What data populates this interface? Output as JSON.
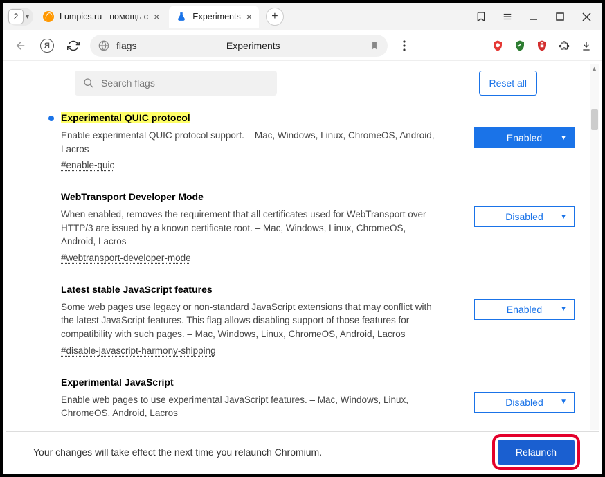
{
  "titlebar": {
    "tab_count": "2",
    "tabs": [
      {
        "label": "Lumpics.ru - помощь с"
      },
      {
        "label": "Experiments"
      }
    ]
  },
  "addrbar": {
    "flags_text": "flags",
    "page_title": "Experiments",
    "ya_letter": "Я"
  },
  "search": {
    "placeholder": "Search flags",
    "reset_label": "Reset all"
  },
  "flags": [
    {
      "title": "Experimental QUIC protocol",
      "highlight": true,
      "dot": true,
      "desc": "Enable experimental QUIC protocol support. – Mac, Windows, Linux, ChromeOS, Android, Lacros",
      "anchor": "#enable-quic",
      "state": "Enabled",
      "filled": true
    },
    {
      "title": "WebTransport Developer Mode",
      "highlight": false,
      "dot": false,
      "desc": "When enabled, removes the requirement that all certificates used for WebTransport over HTTP/3 are issued by a known certificate root. – Mac, Windows, Linux, ChromeOS, Android, Lacros",
      "anchor": "#webtransport-developer-mode",
      "state": "Disabled",
      "filled": false
    },
    {
      "title": "Latest stable JavaScript features",
      "highlight": false,
      "dot": false,
      "desc": "Some web pages use legacy or non-standard JavaScript extensions that may conflict with the latest JavaScript features. This flag allows disabling support of those features for compatibility with such pages. – Mac, Windows, Linux, ChromeOS, Android, Lacros",
      "anchor": "#disable-javascript-harmony-shipping",
      "state": "Enabled",
      "filled": false
    },
    {
      "title": "Experimental JavaScript",
      "highlight": false,
      "dot": false,
      "desc": "Enable web pages to use experimental JavaScript features. – Mac, Windows, Linux, ChromeOS, Android, Lacros",
      "anchor": "",
      "state": "Disabled",
      "filled": false
    }
  ],
  "footer": {
    "message": "Your changes will take effect the next time you relaunch Chromium.",
    "relaunch_label": "Relaunch"
  }
}
